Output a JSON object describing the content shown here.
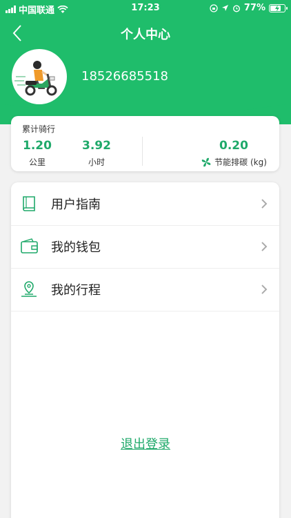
{
  "status": {
    "carrier": "中国联通",
    "time": "17:23",
    "battery_text": "77%",
    "battery_level": 0.77
  },
  "nav": {
    "title": "个人中心"
  },
  "user": {
    "phone": "18526685518"
  },
  "stats": {
    "title": "累计骑行",
    "distance": {
      "value": "1.20",
      "unit": "公里"
    },
    "hours": {
      "value": "3.92",
      "unit": "小时"
    },
    "carbon": {
      "value": "0.20",
      "unit": "节能排碳 (kg)"
    }
  },
  "menu": {
    "items": [
      {
        "label": "用户指南",
        "icon": "book-icon"
      },
      {
        "label": "我的钱包",
        "icon": "wallet-icon"
      },
      {
        "label": "我的行程",
        "icon": "location-pin-icon"
      }
    ]
  },
  "logout_label": "退出登录",
  "colors": {
    "brand_green": "#1fbd6b",
    "text_green": "#1fa96a"
  }
}
